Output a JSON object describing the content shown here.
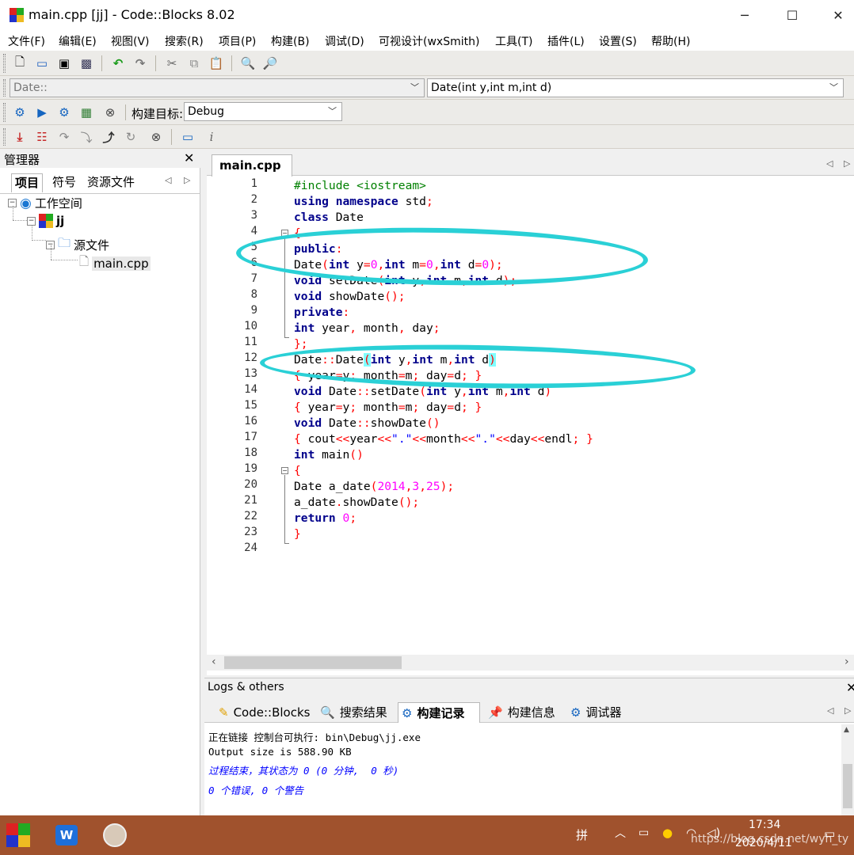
{
  "window": {
    "title": "main.cpp [jj] - Code::Blocks 8.02",
    "minimize": "─",
    "maximize": "☐",
    "close": "✕"
  },
  "menu": [
    "文件(F)",
    "编辑(E)",
    "视图(V)",
    "搜索(R)",
    "项目(P)",
    "构建(B)",
    "调试(D)",
    "可视设计(wxSmith)",
    "工具(T)",
    "插件(L)",
    "设置(S)",
    "帮助(H)"
  ],
  "scope_combo": "Date::",
  "function_combo": "Date(int y,int m,int d)",
  "build_target": {
    "label": "构建目标:",
    "value": "Debug"
  },
  "manager": {
    "title": "管理器",
    "close": "✕",
    "tabs": [
      "项目",
      "符号",
      "资源文件"
    ],
    "tree": {
      "workspace": "工作空间",
      "project": "jj",
      "folder": "源文件",
      "file": "main.cpp"
    }
  },
  "editor": {
    "tab": "main.cpp",
    "tab_close": "✕",
    "line_numbers": [
      "1",
      "2",
      "3",
      "4",
      "5",
      "6",
      "7",
      "8",
      "9",
      "10",
      "11",
      "12",
      "13",
      "14",
      "15",
      "16",
      "17",
      "18",
      "19",
      "20",
      "21",
      "22",
      "23",
      "24"
    ]
  },
  "logs": {
    "title": "Logs & others",
    "close": "✕",
    "tabs": [
      "Code::Blocks",
      "搜索结果",
      "构建记录",
      "构建信息",
      "调试器"
    ],
    "lines": [
      "正在链接 控制台可执行: bin\\Debug\\jj.exe",
      "Output size is 588.90 KB",
      "过程结束，其状态为 0 (0 分钟,  0 秒)",
      "0 个错误, 0 个警告"
    ]
  },
  "taskbar": {
    "ime": "拼",
    "time": "17:34",
    "date": "2020/4/11",
    "watermark": "https://blog.csdn.net/wyh_ty"
  },
  "colors": {
    "highlight_ellipse": "#2ad0d6",
    "keyword": "#00008b",
    "preprocessor": "#008000",
    "number": "#ff00ff",
    "operator": "#ff0000",
    "taskbar": "#a0522d"
  }
}
